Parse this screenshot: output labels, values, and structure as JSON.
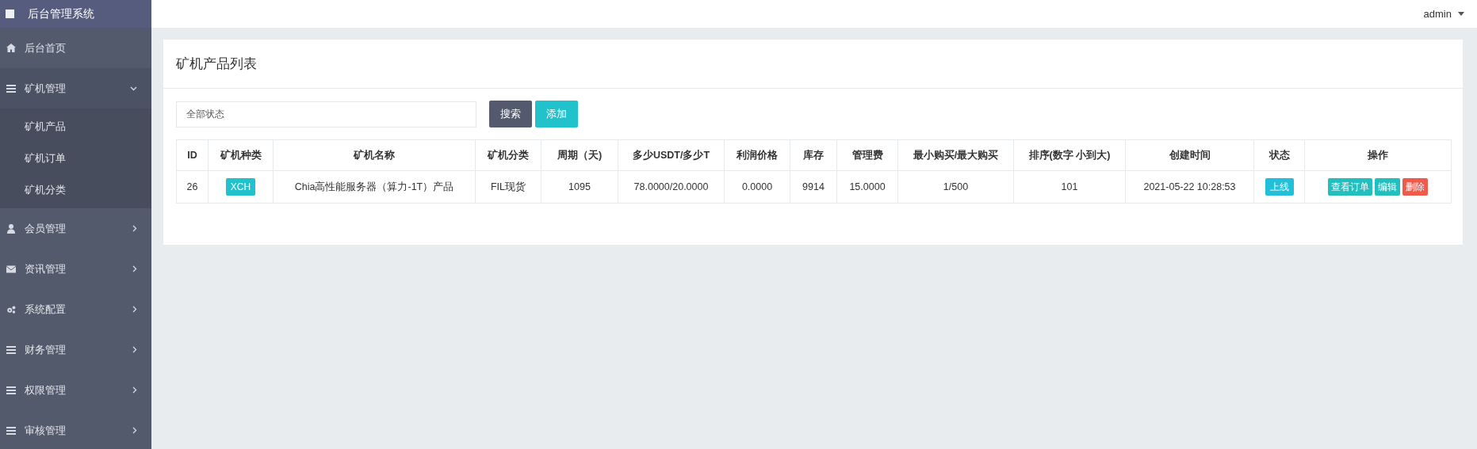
{
  "sidebar": {
    "title": "后台管理系统",
    "items": [
      {
        "label": "后台首页"
      },
      {
        "label": "矿机管理",
        "expanded": true,
        "children": [
          {
            "label": "矿机产品"
          },
          {
            "label": "矿机订单"
          },
          {
            "label": "矿机分类"
          }
        ]
      },
      {
        "label": "会员管理",
        "expanded": false
      },
      {
        "label": "资讯管理",
        "expanded": false
      },
      {
        "label": "系统配置",
        "expanded": false
      },
      {
        "label": "财务管理",
        "expanded": false
      },
      {
        "label": "权限管理",
        "expanded": false
      },
      {
        "label": "审核管理",
        "expanded": false
      }
    ]
  },
  "header": {
    "user": "admin"
  },
  "card": {
    "title": "矿机产品列表",
    "filter": {
      "placeholder": "全部状态"
    },
    "buttons": [
      {
        "label": "搜索",
        "color": "#535a6d"
      },
      {
        "label": "添加",
        "color": "#21c2cc"
      }
    ],
    "table": {
      "columns": [
        "ID",
        "矿机种类",
        "矿机名称",
        "矿机分类",
        "周期（天)",
        "多少USDT/多少T",
        "利润价格",
        "库存",
        "管理费",
        "最小购买/最大购买",
        "排序(数字 小到大)",
        "创建时间",
        "状态",
        "操作"
      ],
      "rows": [
        {
          "id": "26",
          "kind_badge": "XCH",
          "name": "Chia高性能服务器（算力-1T）产品",
          "category": "FIL现货",
          "period": "1095",
          "price": "78.0000/20.0000",
          "profit": "0.0000",
          "stock": "9914",
          "fee": "15.0000",
          "limits": "1/500",
          "sort": "101",
          "created": "2021-05-22 10:28:53",
          "status": {
            "label": "上线",
            "color": "#22bfd9"
          },
          "actions": [
            {
              "label": "查看订单",
              "color": "#23bfbf"
            },
            {
              "label": "编辑",
              "color": "#23bfbf"
            },
            {
              "label": "删除",
              "color": "#f05a4b"
            }
          ]
        }
      ]
    }
  }
}
